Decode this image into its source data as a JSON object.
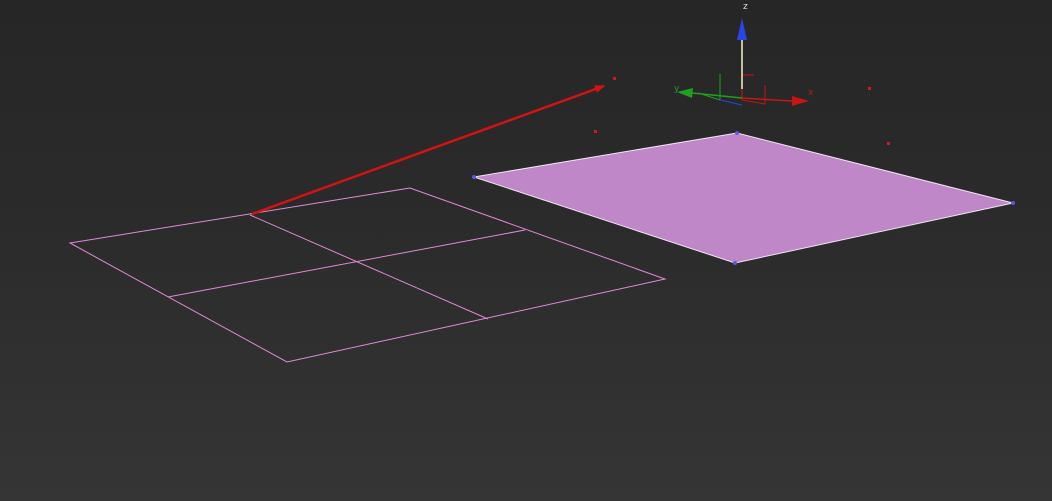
{
  "viewport": {
    "background_top": "#262626",
    "background_bottom": "#353535"
  },
  "gizmo": {
    "x_label": "x",
    "y_label": "y",
    "z_label": "z",
    "x_color": "#c81414",
    "y_color": "#1fa01f",
    "z_color": "#2a44e8",
    "center_color": "#f2f2c8"
  },
  "objects": {
    "wire_plane_color": "#e08ad8",
    "solid_plane_fill": "#bf86c8",
    "solid_plane_edge": "#f0e6f2",
    "vertex_color": "#5a5ae0",
    "bbox_marker_color": "#cc1b1b",
    "arrow_color": "#d41212"
  }
}
